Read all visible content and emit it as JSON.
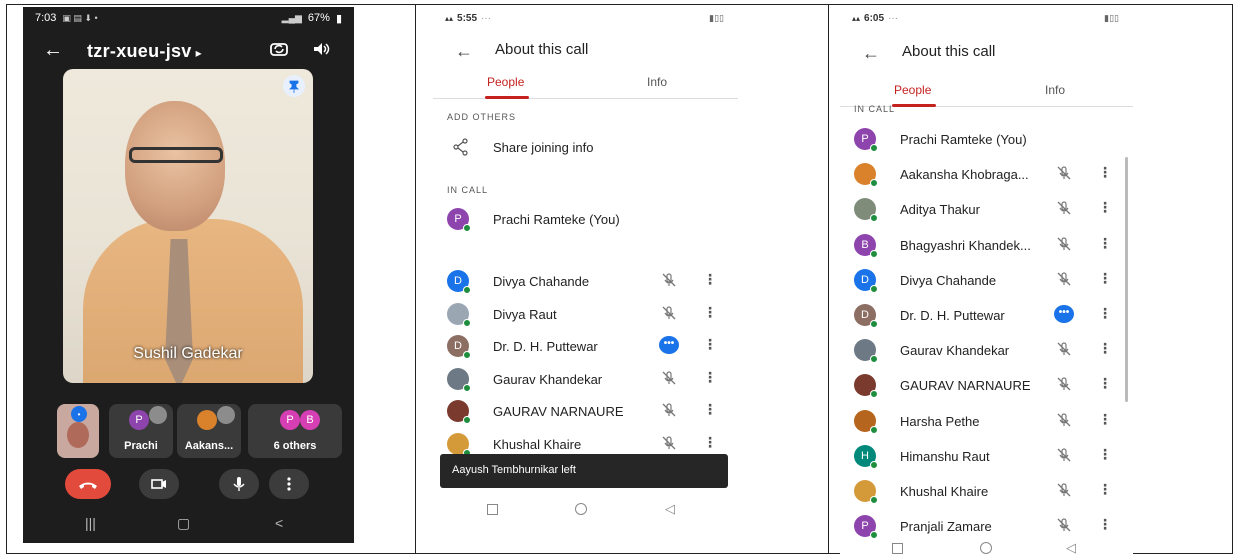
{
  "panel1": {
    "status": {
      "time": "7:03",
      "battery": "67%"
    },
    "meeting_code": "tzr-xueu-jsv",
    "video_name": "Sushil Gadekar",
    "tiles": [
      {
        "label": "",
        "avatar": ""
      },
      {
        "label": "Prachi",
        "avatar": "P"
      },
      {
        "label": "Aakans...",
        "avatar": ""
      },
      {
        "label": "6 others",
        "avatar1": "P",
        "avatar2": "B"
      }
    ],
    "colors": {
      "hangup": "#e24a3b",
      "tile_bg": "#3a3a3a",
      "screen_bg": "#1d1d1d"
    }
  },
  "panel2": {
    "status": {
      "time": "5:55"
    },
    "title": "About this call",
    "tabs": [
      "People",
      "Info"
    ],
    "section_add": "ADD OTHERS",
    "share_label": "Share joining info",
    "section_in_call": "IN CALL",
    "self": {
      "name": "Prachi Ramteke (You)",
      "initial": "P",
      "color": "#8e44ad"
    },
    "people": [
      {
        "name": "Divya Chahande",
        "initial": "D",
        "color": "#1a73e8",
        "state": "muted"
      },
      {
        "name": "Divya Raut",
        "initial": "",
        "color": "#9aa7b3",
        "state": "muted"
      },
      {
        "name": "Dr. D. H. Puttewar",
        "initial": "D",
        "color": "#8d6e63",
        "state": "speaking"
      },
      {
        "name": "Gaurav Khandekar",
        "initial": "",
        "color": "#6d7a85",
        "state": "muted"
      },
      {
        "name": "GAURAV NARNAURE",
        "initial": "",
        "color": "#7a3b2e",
        "state": "muted"
      },
      {
        "name": "Khushal Khaire",
        "initial": "",
        "color": "#d49a3a",
        "state": "muted"
      }
    ],
    "toast": "Aayush Tembhurnikar left"
  },
  "panel3": {
    "status": {
      "time": "6:05"
    },
    "title": "About this call",
    "tabs": [
      "People",
      "Info"
    ],
    "section_in_call": "IN CALL",
    "people": [
      {
        "name": "Prachi Ramteke (You)",
        "initial": "P",
        "color": "#8e44ad",
        "state": "self"
      },
      {
        "name": "Aakansha Khobraga...",
        "initial": "",
        "color": "#d9822b",
        "state": "muted"
      },
      {
        "name": "Aditya Thakur",
        "initial": "",
        "color": "#7f8c7a",
        "state": "muted"
      },
      {
        "name": "Bhagyashri Khandek...",
        "initial": "B",
        "color": "#8e44ad",
        "state": "muted"
      },
      {
        "name": "Divya Chahande",
        "initial": "D",
        "color": "#1a73e8",
        "state": "muted"
      },
      {
        "name": "Dr. D. H. Puttewar",
        "initial": "D",
        "color": "#8d6e63",
        "state": "speaking"
      },
      {
        "name": "Gaurav Khandekar",
        "initial": "",
        "color": "#6d7a85",
        "state": "muted"
      },
      {
        "name": "GAURAV NARNAURE",
        "initial": "",
        "color": "#7a3b2e",
        "state": "muted"
      },
      {
        "name": "Harsha Pethe",
        "initial": "",
        "color": "#b5651d",
        "state": "muted"
      },
      {
        "name": "Himanshu Raut",
        "initial": "H",
        "color": "#00897b",
        "state": "muted"
      },
      {
        "name": "Khushal Khaire",
        "initial": "",
        "color": "#d49a3a",
        "state": "muted"
      },
      {
        "name": "Pranjali Zamare",
        "initial": "P",
        "color": "#8e44ad",
        "state": "muted"
      }
    ]
  },
  "icons": {
    "back": "arrow-back-icon",
    "mic_off": "mic-off-icon",
    "more": "more-vert-icon",
    "share": "share-icon"
  }
}
